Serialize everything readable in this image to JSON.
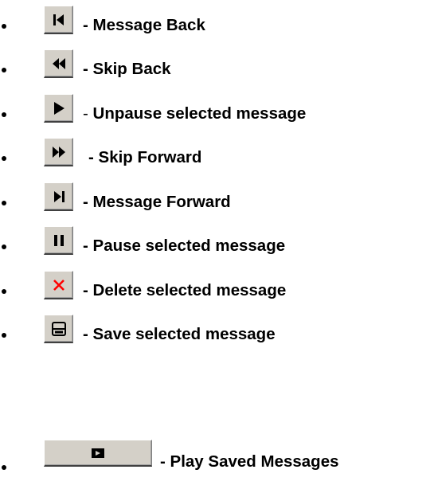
{
  "items": [
    {
      "icon": "message-back-icon",
      "dash": "-",
      "label": "Message Back"
    },
    {
      "icon": "skip-back-icon",
      "dash": "-",
      "label": "Skip Back"
    },
    {
      "icon": "play-icon",
      "dash": "-",
      "label": "Unpause selected message"
    },
    {
      "icon": "skip-forward-icon",
      "dash": "-",
      "label": "Skip Forward"
    },
    {
      "icon": "message-forward-icon",
      "dash": "-",
      "label": "Message Forward"
    },
    {
      "icon": "pause-icon",
      "dash": "-",
      "label": "Pause selected message"
    },
    {
      "icon": "delete-icon",
      "dash": "-",
      "label": "Delete selected message"
    },
    {
      "icon": "save-icon",
      "dash": "-",
      "label": "Save selected message"
    },
    {
      "icon": "play-saved-icon",
      "dash": "-",
      "label": "Play Saved Messages"
    }
  ],
  "colors": {
    "button_face": "#d4d0c8",
    "icon": "#000000",
    "delete_icon": "#ff0000"
  }
}
